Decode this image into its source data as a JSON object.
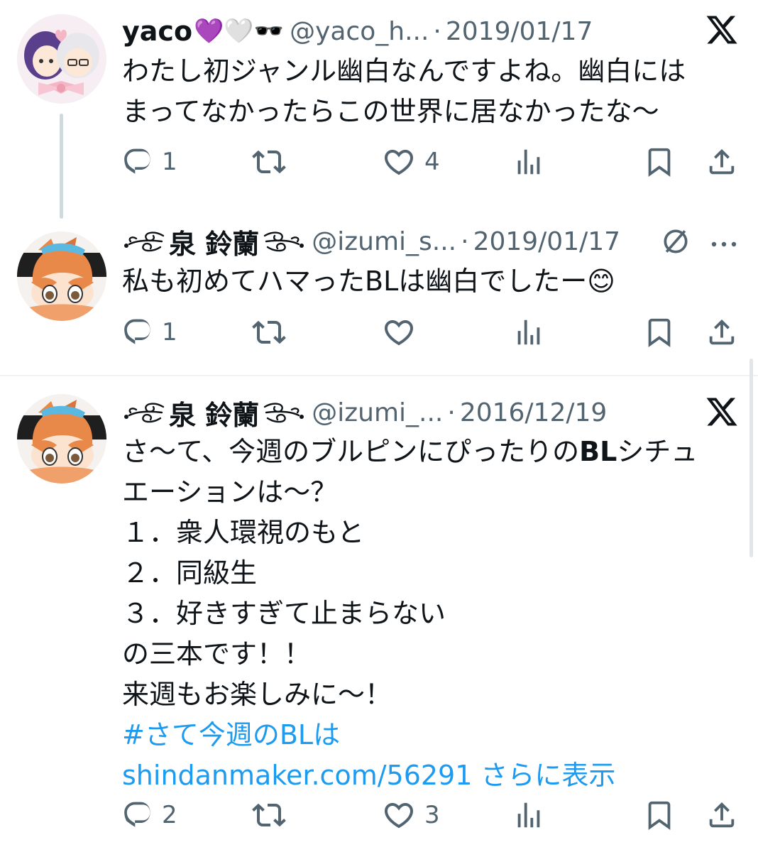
{
  "colors": {
    "text": "#0f1419",
    "secondary": "#536471",
    "link": "#1d9bf0",
    "divider": "#eff3f4",
    "thread_line": "#cfd9de"
  },
  "tweets": [
    {
      "avatar_icon": "couple-illustration-avatar",
      "name": "yaco",
      "name_emojis": "💜🤍🕶️",
      "handle": "@yaco_h...",
      "separator": "·",
      "date": "2019/01/17",
      "corner_icon": "x-logo-icon",
      "lines": [
        "わたし初ジャンル幽白なんですよね。幽白には",
        "まってなかったらこの世界に居なかったな〜"
      ],
      "replies": "1",
      "retweets": "",
      "likes": "4"
    },
    {
      "avatar_icon": "plush-character-avatar",
      "name_deco_left": "꧁",
      "name": "泉 鈴蘭",
      "name_deco_right": "꧂",
      "handle": "@izumi_s...",
      "separator": "·",
      "date": "2019/01/17",
      "corner_icons": [
        "ban-icon",
        "more-icon"
      ],
      "lines": [
        "私も初めてハマったBLは幽白でしたー😊"
      ],
      "replies": "1",
      "retweets": "",
      "likes": ""
    },
    {
      "avatar_icon": "plush-character-avatar",
      "name": "泉 鈴蘭",
      "handle": "@izumi_...",
      "separator": "·",
      "date": "2016/12/19",
      "corner_icon": "x-logo-icon",
      "line1_prefix": "さ〜て、今週のブルピンにぴったりの",
      "line1_bold": "BL",
      "line1_suffix": "シチュ",
      "lines": [
        "エーションは〜？",
        "１．衆人環視のもと",
        "２．同級生",
        "３．好きすぎて止まらない",
        "の三本です！！",
        "来週もお楽しみに〜！"
      ],
      "hashtag": "#さて今週のBLは",
      "url": "shindanmaker.com/56291",
      "show_more": "さらに表示",
      "replies": "2",
      "retweets": "",
      "likes": "3"
    }
  ]
}
